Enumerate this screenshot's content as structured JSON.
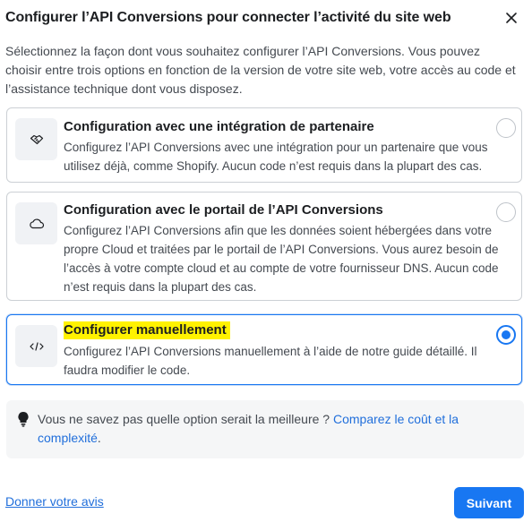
{
  "dialog": {
    "title": "Configurer l’API Conversions pour connecter l’activité du site web",
    "close_icon": "close-icon",
    "intro": "Sélectionnez la façon dont vous souhaitez configurer l’API Conversions. Vous pouvez choisir entre trois options en fonction de la version de votre site web, votre accès au code et l’assistance technique dont vous disposez."
  },
  "options": [
    {
      "icon": "handshake-icon",
      "title": "Configuration avec une intégration de partenaire",
      "description": "Configurez l’API Conversions avec une intégration pour un partenaire que vous utilisez déjà, comme Shopify. Aucun code n’est requis dans la plupart des cas.",
      "selected": false
    },
    {
      "icon": "cloud-icon",
      "title": "Configuration avec le portail de l’API Conversions",
      "description": "Configurez l’API Conversions afin que les données soient hébergées dans votre propre Cloud et traitées par le portail de l’API Conversions. Vous aurez besoin de l’accès à votre compte cloud et au compte de votre fournisseur DNS. Aucun code n’est requis dans la plupart des cas.",
      "selected": false
    },
    {
      "icon": "code-icon",
      "title": "Configurer manuellement",
      "description": "Configurez l’API Conversions manuellement à l’aide de notre guide détaillé. Il faudra modifier le code.",
      "selected": true,
      "highlight_color": "#fff200"
    }
  ],
  "tip": {
    "icon": "lightbulb-icon",
    "text": "Vous ne savez pas quelle option serait la meilleure ? ",
    "link": "Comparez le coût et la complexité",
    "suffix": "."
  },
  "footer": {
    "feedback_link": "Donner votre avis",
    "next_button": "Suivant"
  },
  "colors": {
    "accent": "#1877f2",
    "link": "#216fdb",
    "border": "#ccd0d5",
    "tip_bg": "#f5f6f7"
  }
}
